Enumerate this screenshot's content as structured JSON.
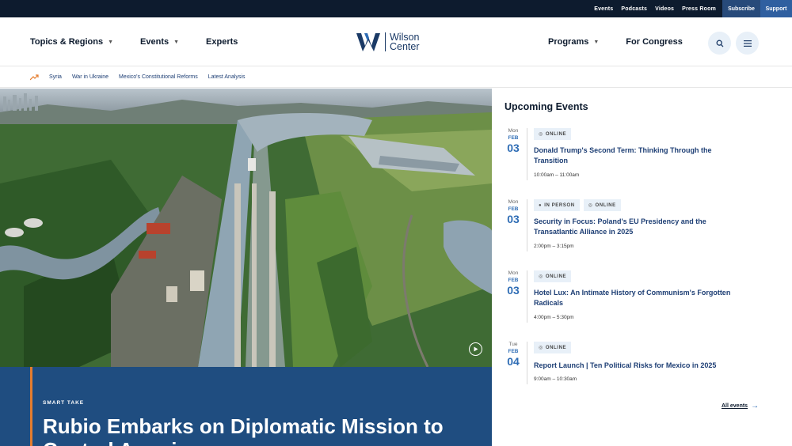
{
  "utility_bar": {
    "links": [
      "Events",
      "Podcasts",
      "Videos",
      "Press Room"
    ],
    "subscribe_label": "Subscribe",
    "support_label": "Support"
  },
  "header": {
    "nav_left": [
      {
        "label": "Topics & Regions",
        "has_dropdown": true
      },
      {
        "label": "Events",
        "has_dropdown": true
      },
      {
        "label": "Experts",
        "has_dropdown": false
      }
    ],
    "logo_line1": "Wilson",
    "logo_line2": "Center",
    "nav_right": [
      {
        "label": "Programs",
        "has_dropdown": true
      },
      {
        "label": "For Congress",
        "has_dropdown": false
      }
    ],
    "search_icon": "search-icon",
    "menu_icon": "hamburger-menu-icon"
  },
  "trending": {
    "icon": "trending-up-icon",
    "links": [
      "Syria",
      "War in Ukraine",
      "Mexico's Constitutional Reforms",
      "Latest Analysis"
    ]
  },
  "hero": {
    "eyebrow": "SMART TAKE",
    "title": "Rubio Embarks on Diplomatic Mission to Central America",
    "play_icon": "play-icon",
    "accent_color": "#e57d2e",
    "panel_color": "#1f4d80"
  },
  "events": {
    "heading": "Upcoming Events",
    "items": [
      {
        "dow": "Mon",
        "month": "FEB",
        "day": "03",
        "badges": [
          "ONLINE"
        ],
        "title": "Donald Trump's Second Term: Thinking Through the Transition",
        "time": "10:00am – 11:00am"
      },
      {
        "dow": "Mon",
        "month": "FEB",
        "day": "03",
        "badges": [
          "IN PERSON",
          "ONLINE"
        ],
        "title": "Security in Focus: Poland's EU Presidency and the Transatlantic Alliance in 2025",
        "time": "2:00pm – 3:15pm"
      },
      {
        "dow": "Mon",
        "month": "FEB",
        "day": "03",
        "badges": [
          "ONLINE"
        ],
        "title": "Hotel Lux: An Intimate History of Communism's Forgotten Radicals",
        "time": "4:00pm – 5:30pm"
      },
      {
        "dow": "Tue",
        "month": "FEB",
        "day": "04",
        "badges": [
          "ONLINE"
        ],
        "title": "Report Launch | Ten Political Risks for Mexico in 2025",
        "time": "9:00am – 10:30am"
      }
    ],
    "all_events_label": "All events",
    "accent_color": "#2f6db5"
  }
}
